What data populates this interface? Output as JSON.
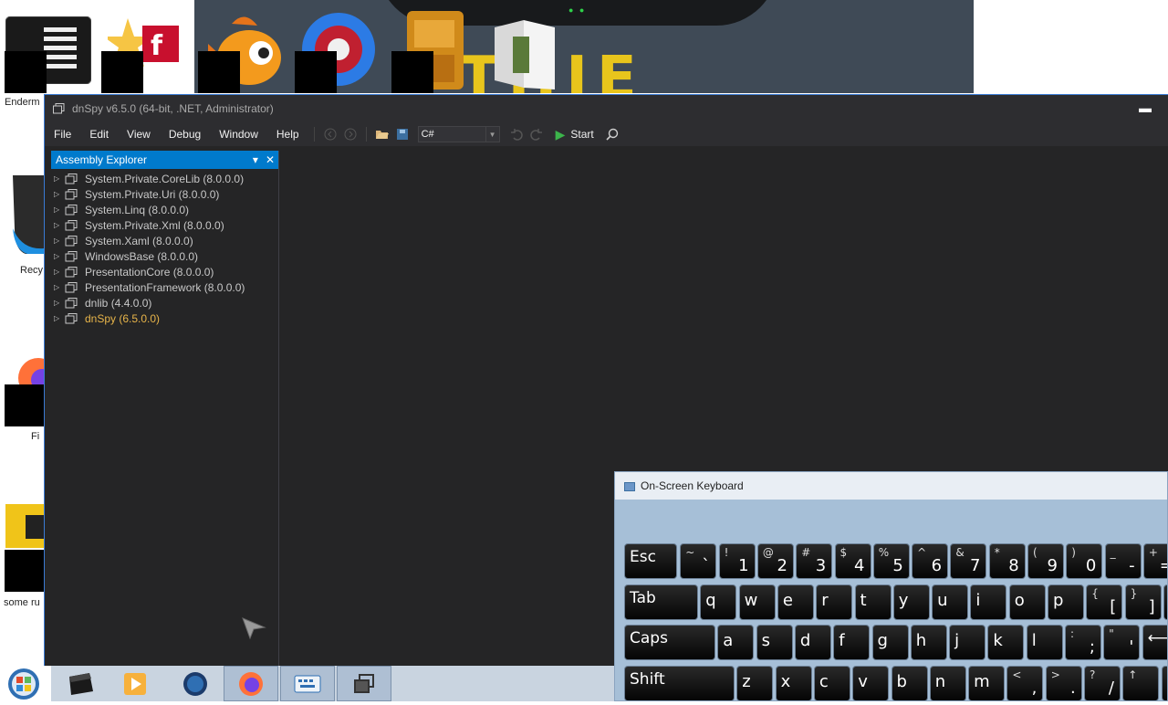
{
  "desktop": {
    "wallpaper_text": "THIE",
    "icons": [
      {
        "label": "Enderm"
      },
      {
        "label": "Recy"
      },
      {
        "label": "Fi"
      },
      {
        "label": "some ru"
      }
    ]
  },
  "dnspy": {
    "title": "dnSpy v6.5.0 (64-bit, .NET, Administrator)",
    "minimize_glyph": "▬",
    "menus": [
      "File",
      "Edit",
      "View",
      "Debug",
      "Window",
      "Help"
    ],
    "language": "C#",
    "start_label": "Start",
    "explorer": {
      "title": "Assembly Explorer",
      "items": [
        {
          "label": "System.Private.CoreLib (8.0.0.0)"
        },
        {
          "label": "System.Private.Uri (8.0.0.0)"
        },
        {
          "label": "System.Linq (8.0.0.0)"
        },
        {
          "label": "System.Private.Xml (8.0.0.0)"
        },
        {
          "label": "System.Xaml (8.0.0.0)"
        },
        {
          "label": "WindowsBase (8.0.0.0)"
        },
        {
          "label": "PresentationCore (8.0.0.0)"
        },
        {
          "label": "PresentationFramework (8.0.0.0)"
        },
        {
          "label": "dnlib (4.4.0.0)"
        },
        {
          "label": "dnSpy (6.5.0.0)"
        }
      ]
    }
  },
  "osk": {
    "title": "On-Screen Keyboard",
    "rows": [
      [
        {
          "wide": "Esc"
        },
        {
          "shift": "~",
          "base": "`"
        },
        {
          "shift": "!",
          "base": "1"
        },
        {
          "shift": "@",
          "base": "2"
        },
        {
          "shift": "#",
          "base": "3"
        },
        {
          "shift": "$",
          "base": "4"
        },
        {
          "shift": "%",
          "base": "5"
        },
        {
          "shift": "^",
          "base": "6"
        },
        {
          "shift": "&",
          "base": "7"
        },
        {
          "shift": "*",
          "base": "8"
        },
        {
          "shift": "(",
          "base": "9"
        },
        {
          "shift": ")",
          "base": "0"
        },
        {
          "shift": "_",
          "base": "-"
        },
        {
          "shift": "+",
          "base": "="
        }
      ],
      [
        {
          "wide": "Tab"
        },
        {
          "main": "q"
        },
        {
          "main": "w"
        },
        {
          "main": "e"
        },
        {
          "main": "r"
        },
        {
          "main": "t"
        },
        {
          "main": "y"
        },
        {
          "main": "u"
        },
        {
          "main": "i"
        },
        {
          "main": "o"
        },
        {
          "main": "p"
        },
        {
          "shift": "{",
          "base": "["
        },
        {
          "shift": "}",
          "base": "]"
        },
        {
          "shift": "|",
          "base": "\\"
        }
      ],
      [
        {
          "wide": "Caps"
        },
        {
          "main": "a"
        },
        {
          "main": "s"
        },
        {
          "main": "d"
        },
        {
          "main": "f"
        },
        {
          "main": "g"
        },
        {
          "main": "h"
        },
        {
          "main": "j"
        },
        {
          "main": "k"
        },
        {
          "main": "l"
        },
        {
          "shift": ":",
          "base": ";"
        },
        {
          "shift": "\"",
          "base": "'"
        },
        {
          "wide": "⟵"
        }
      ],
      [
        {
          "wide": "Shift"
        },
        {
          "main": "z"
        },
        {
          "main": "x"
        },
        {
          "main": "c"
        },
        {
          "main": "v"
        },
        {
          "main": "b"
        },
        {
          "main": "n"
        },
        {
          "main": "m"
        },
        {
          "shift": "<",
          "base": ","
        },
        {
          "shift": ">",
          "base": "."
        },
        {
          "shift": "?",
          "base": "/"
        },
        {
          "shift": "↑",
          "base": ""
        },
        {
          "wide": "S"
        }
      ]
    ]
  },
  "colors": {
    "accent": "#007acc",
    "highlight": "#e8b54a",
    "run_green": "#3cb44b"
  }
}
